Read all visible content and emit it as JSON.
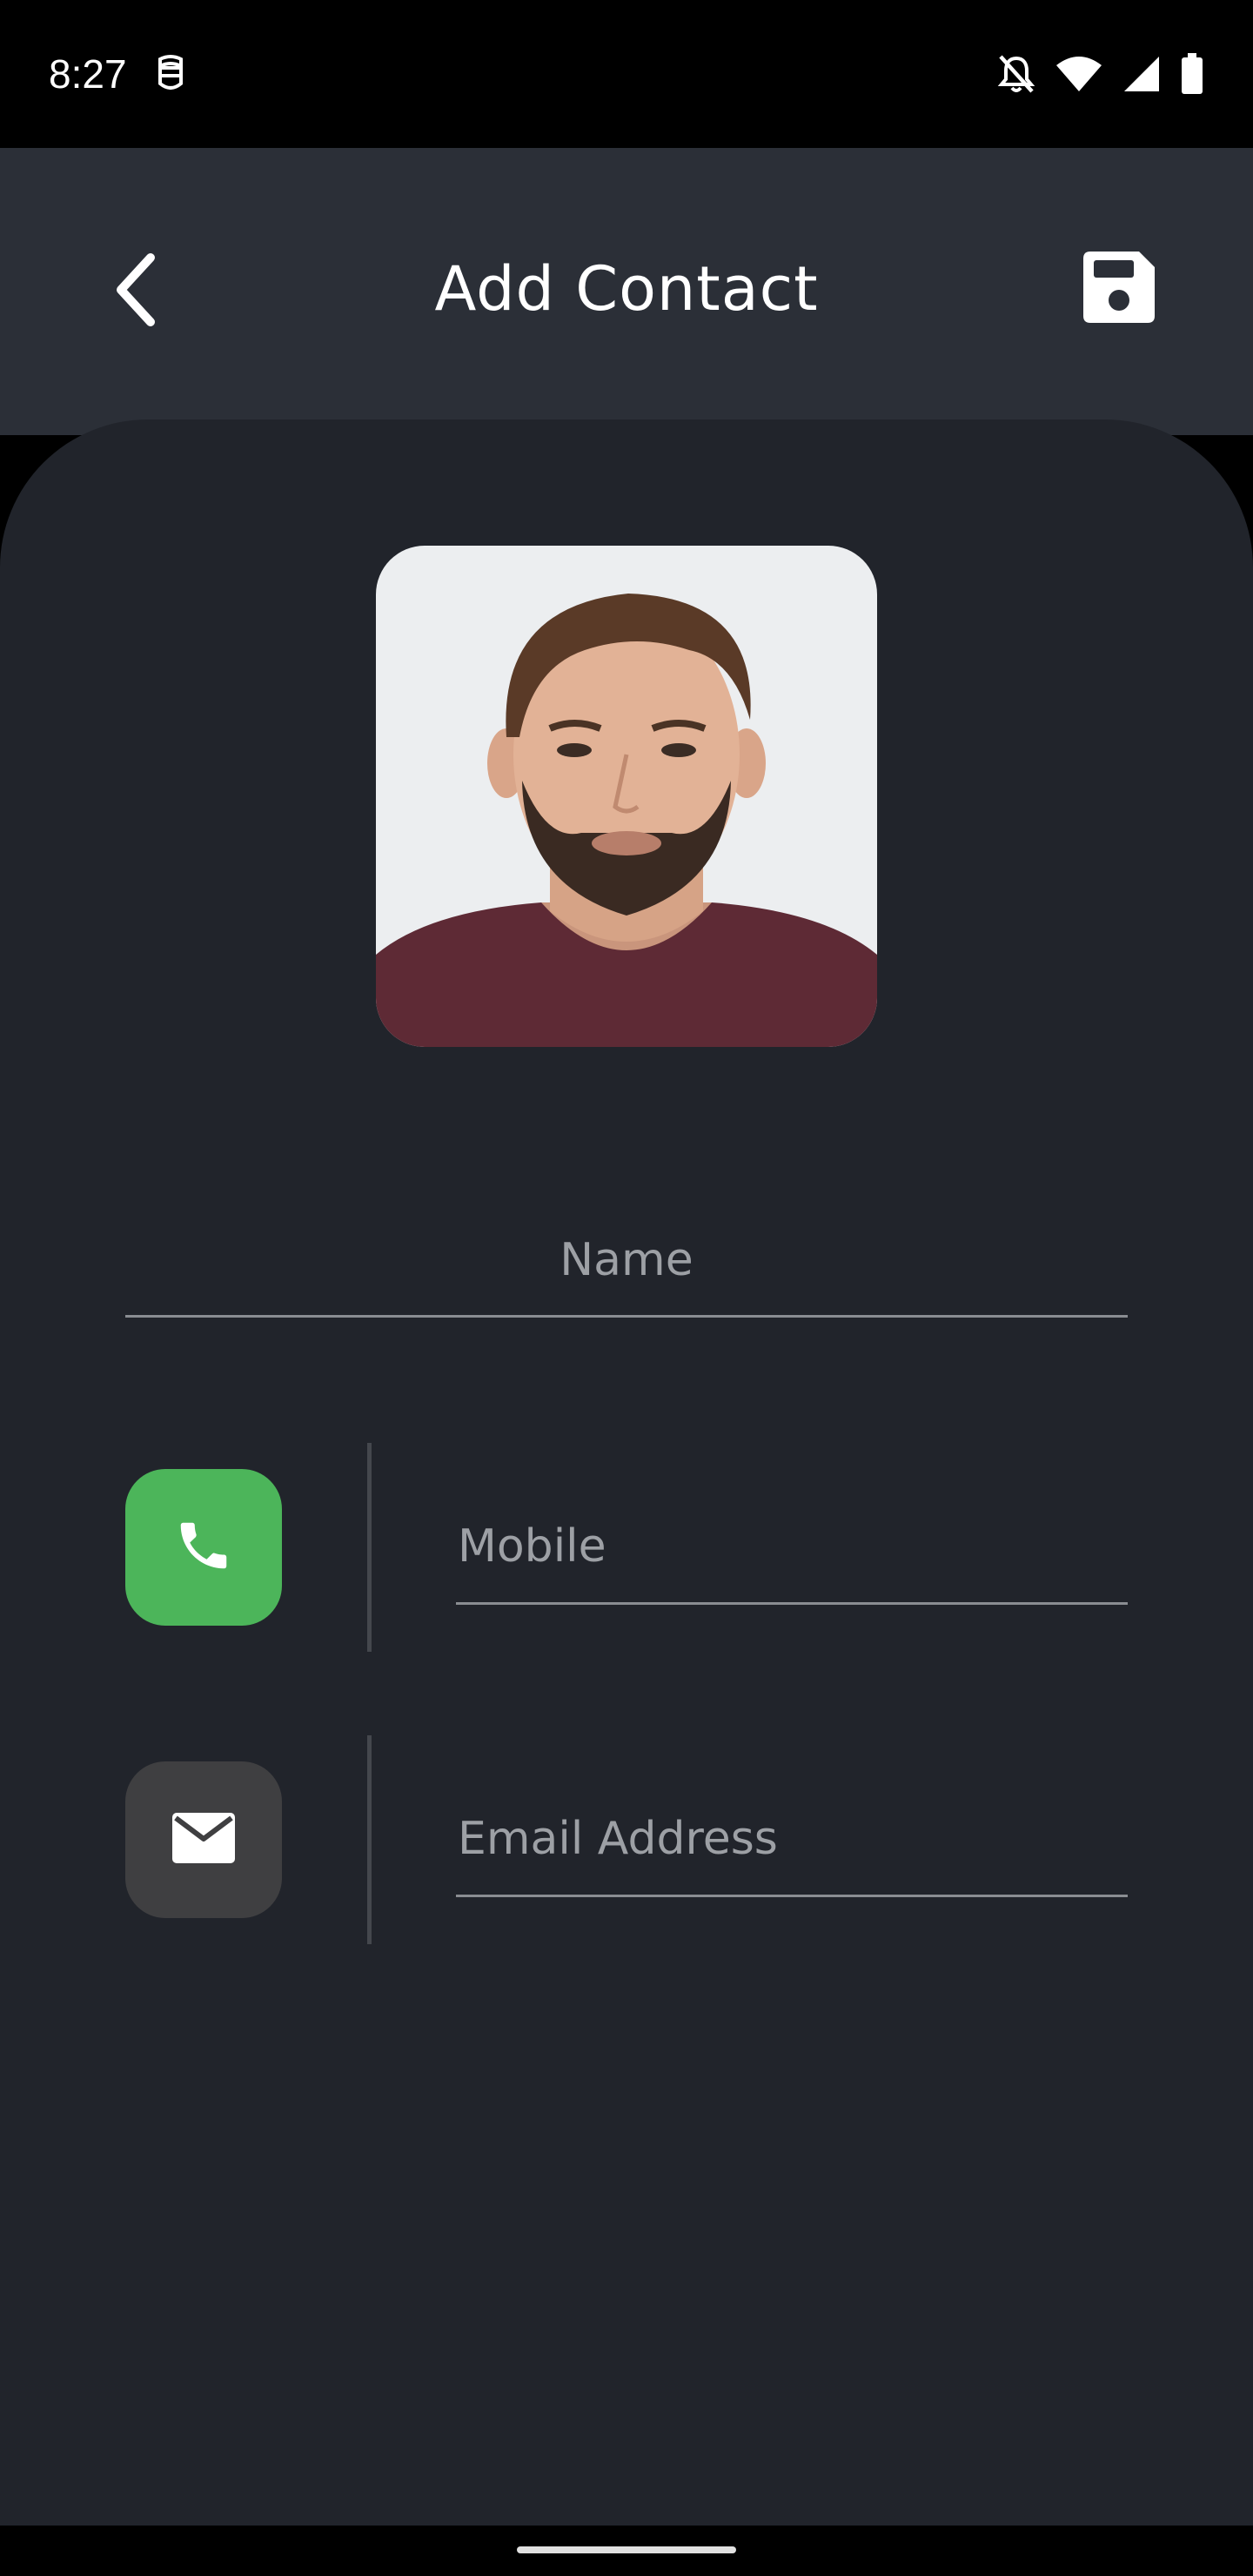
{
  "status_bar": {
    "time": "8:27",
    "icons": [
      "notification-app-icon",
      "bell-off-icon",
      "wifi-icon",
      "signal-icon",
      "battery-icon"
    ]
  },
  "header": {
    "title": "Add Contact",
    "back_icon": "chevron-left-icon",
    "save_icon": "floppy-disk-icon"
  },
  "form": {
    "avatar_description": "contact photo",
    "name_placeholder": "Name",
    "name_value": "",
    "mobile_placeholder": "Mobile",
    "mobile_value": "",
    "email_placeholder": "Email Address",
    "email_value": ""
  },
  "colors": {
    "header_bg": "#2b2f37",
    "card_bg": "#21242b",
    "phone_tile": "#4cb55a",
    "email_tile": "#3f3f41",
    "placeholder_text": "#9da0a5",
    "underline": "#8a8d92"
  }
}
